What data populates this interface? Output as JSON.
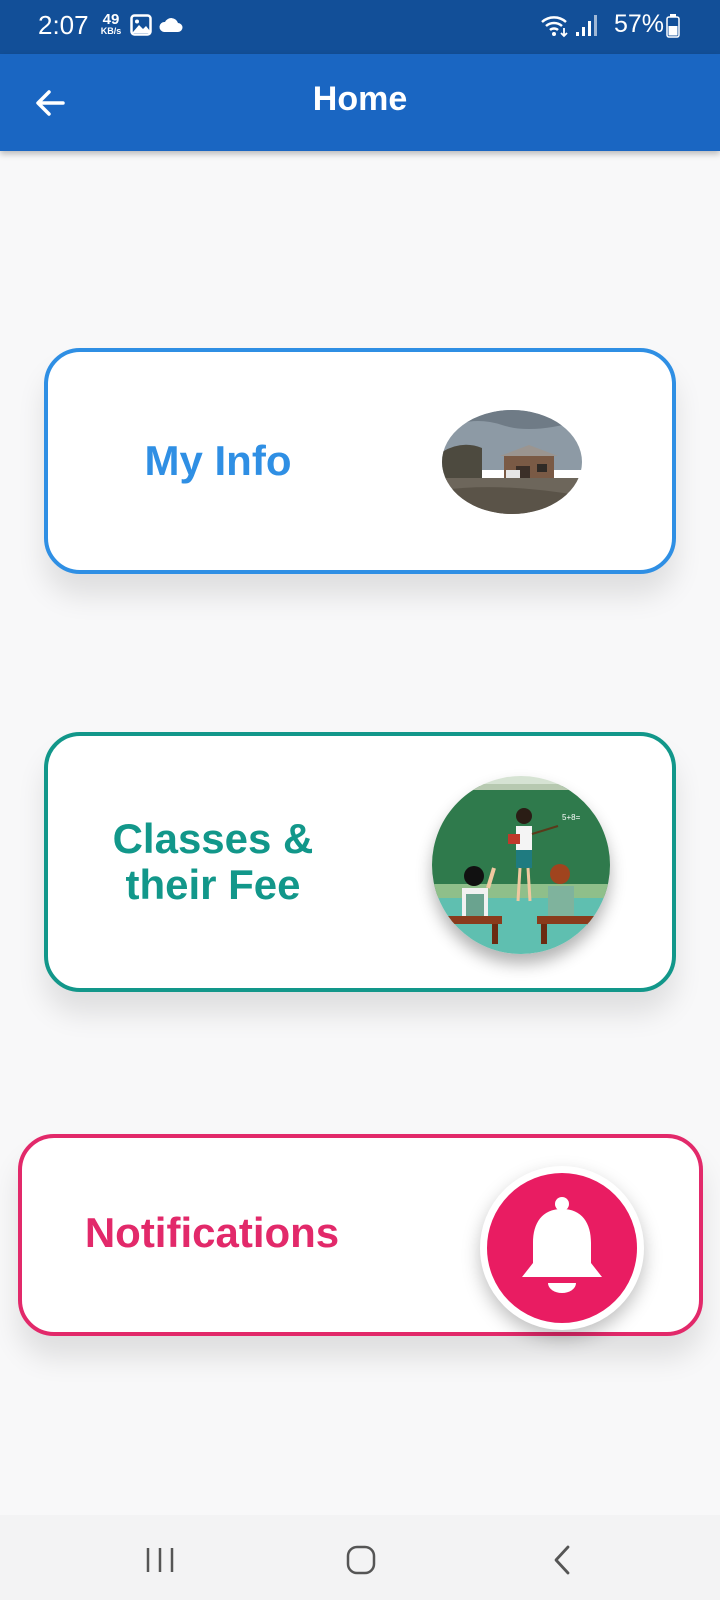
{
  "status_bar": {
    "time": "2:07",
    "net_speed_value": "49",
    "net_speed_unit": "KB/s",
    "battery_percent": "57%",
    "icons": [
      "gallery-icon",
      "cloud-icon",
      "wifi-icon",
      "signal-icon",
      "battery-icon"
    ]
  },
  "app_bar": {
    "title": "Home",
    "back_icon": "arrow-left-icon"
  },
  "cards": [
    {
      "label": "My Info",
      "image": "house-photo",
      "color": "#2f8fe4"
    },
    {
      "label": "Classes & their Fee",
      "image": "classroom-illustration",
      "color": "#12978a"
    },
    {
      "label": "Notifications",
      "image": "bell-icon",
      "color": "#e2296a"
    }
  ],
  "nav_bar": {
    "buttons": [
      "recents-icon",
      "home-icon",
      "back-icon"
    ]
  },
  "colors": {
    "status_bar": "#124f98",
    "app_bar": "#1a66c2",
    "notification_accent": "#e91c62"
  }
}
